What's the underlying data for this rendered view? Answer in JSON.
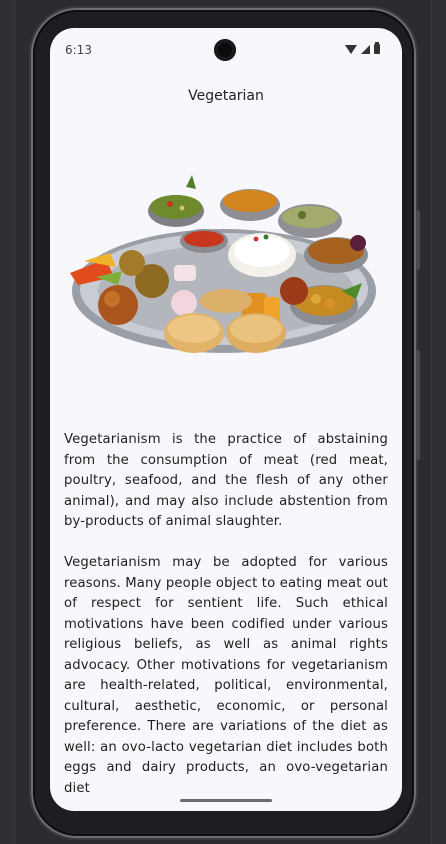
{
  "status_bar": {
    "time": "6:13",
    "icons": [
      "wifi-icon",
      "signal-icon",
      "battery-icon"
    ]
  },
  "app_bar": {
    "title": "Vegetarian"
  },
  "hero_image": {
    "subject": "vegetarian thali platter"
  },
  "article": {
    "paragraph_1": "Vegetarianism is the practice of abstaining from the consumption of meat (red meat, poultry, seafood, and the flesh of any other animal), and may also include abstention from by-products of animal slaughter.",
    "paragraph_2": "Vegetarianism may be adopted for various reasons. Many people object to eating meat out of respect for sentient life. Such ethical motivations have been codified under various religious beliefs, as well as animal rights advocacy. Other motivations for vegetarianism are health-related, political, environmental, cultural, aesthetic, economic, or personal preference. There are variations of the diet as well: an ovo-lacto vegetarian diet includes both eggs and dairy products, an ovo-vegetarian diet"
  },
  "colors": {
    "screen_background": "#f8f7fc",
    "text": "#1f1f1f",
    "frame": "#1d1e21"
  }
}
